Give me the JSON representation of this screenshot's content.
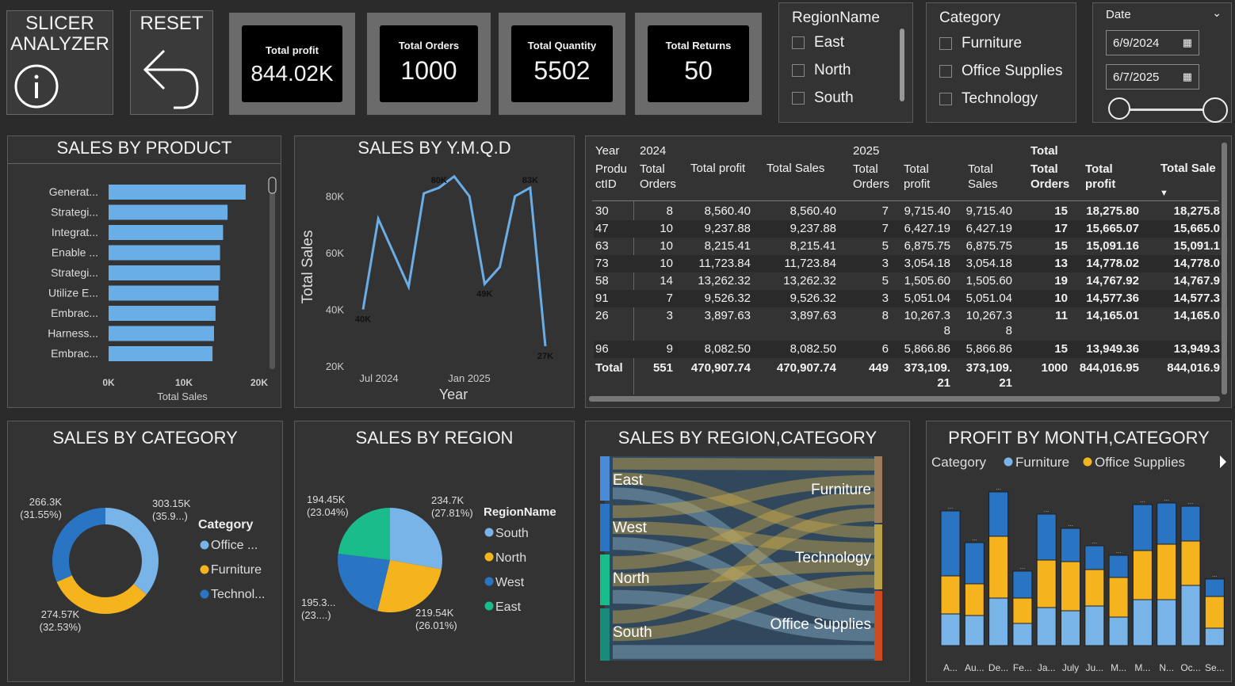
{
  "app": {
    "title_line1": "SLICER",
    "title_line2": "ANALYZER",
    "reset_label": "RESET"
  },
  "kpis": [
    {
      "label": "Total profit",
      "value": "844.02K"
    },
    {
      "label": "Total Orders",
      "value": "1000"
    },
    {
      "label": "Total Quantity",
      "value": "5502"
    },
    {
      "label": "Total Returns",
      "value": "50"
    }
  ],
  "region_slicer": {
    "title": "RegionName",
    "items": [
      "East",
      "North",
      "South"
    ]
  },
  "category_slicer": {
    "title": "Category",
    "items": [
      "Furniture",
      "Office Supplies",
      "Technology"
    ]
  },
  "date_slicer": {
    "title": "Date",
    "start": "6/9/2024",
    "end": "6/7/2025"
  },
  "colors": {
    "furniture": "#f5b41e",
    "office": "#79b4e8",
    "technology": "#2a74c4",
    "bar": "#6aaee8",
    "east": "#1abc8c",
    "sankey_band": "#c9a94a"
  },
  "titles": {
    "product": "SALES BY PRODUCT",
    "ymqd": "SALES BY Y.M.Q.D",
    "category": "SALES BY CATEGORY",
    "region": "SALES BY REGION",
    "region_category": "SALES BY REGION,CATEGORY",
    "profit_month": "PROFIT BY MONTH,CATEGORY"
  },
  "matrix": {
    "year_label": "Year",
    "y2024": "2024",
    "y2025": "2025",
    "total_label": "Total",
    "productid_label": "Produ ctID",
    "col_headers": [
      "Total Orders",
      "Total profit",
      "Total Sales",
      "Total Orders",
      "Total profit",
      "Total Sales",
      "Total Orders",
      "Total profit",
      "Total Sale"
    ],
    "rows": [
      [
        "30",
        "8",
        "8,560.40",
        "8,560.40",
        "7",
        "9,715.40",
        "9,715.40",
        "15",
        "18,275.80",
        "18,275.8"
      ],
      [
        "47",
        "10",
        "9,237.88",
        "9,237.88",
        "7",
        "6,427.19",
        "6,427.19",
        "17",
        "15,665.07",
        "15,665.0"
      ],
      [
        "63",
        "10",
        "8,215.41",
        "8,215.41",
        "5",
        "6,875.75",
        "6,875.75",
        "15",
        "15,091.16",
        "15,091.1"
      ],
      [
        "73",
        "10",
        "11,723.84",
        "11,723.84",
        "3",
        "3,054.18",
        "3,054.18",
        "13",
        "14,778.02",
        "14,778.0"
      ],
      [
        "58",
        "14",
        "13,262.32",
        "13,262.32",
        "5",
        "1,505.60",
        "1,505.60",
        "19",
        "14,767.92",
        "14,767.9"
      ],
      [
        "91",
        "7",
        "9,526.32",
        "9,526.32",
        "3",
        "5,051.04",
        "5,051.04",
        "10",
        "14,577.36",
        "14,577.3"
      ],
      [
        "26",
        "3",
        "3,897.63",
        "3,897.63",
        "8",
        "10,267.3 8",
        "10,267.3 8",
        "11",
        "14,165.01",
        "14,165.0"
      ],
      [
        "96",
        "9",
        "8,082.50",
        "8,082.50",
        "6",
        "5,866.86",
        "5,866.86",
        "15",
        "13,949.36",
        "13,949.3"
      ]
    ],
    "total_row": [
      "Total",
      "551",
      "470,907.74",
      "470,907.74",
      "449",
      "373,109. 21",
      "373,109. 21",
      "1000",
      "844,016.95",
      "844,016.9"
    ]
  },
  "chart_data": [
    {
      "id": "product",
      "type": "bar",
      "orientation": "horizontal",
      "categories": [
        "Generat...",
        "Strategi...",
        "Integrat...",
        "Enable ...",
        "Strategi...",
        "Utilize E...",
        "Embrac...",
        "Harness...",
        "Embrac..."
      ],
      "values": [
        18200,
        15800,
        15200,
        14800,
        14800,
        14600,
        14200,
        14000,
        13800
      ],
      "xlabel": "Total Sales",
      "xticks": [
        "0K",
        "10K",
        "20K"
      ],
      "xlim": [
        0,
        20000
      ]
    },
    {
      "id": "ymqd",
      "type": "line",
      "xlabel": "Year",
      "ylabel": "Total Sales",
      "yticks": [
        "20K",
        "40K",
        "60K",
        "80K"
      ],
      "ylim": [
        20000,
        90000
      ],
      "xticks": [
        "Jul 2024",
        "Jan 2025"
      ],
      "values": [
        40000,
        72000,
        60000,
        48000,
        81000,
        83000,
        87000,
        80000,
        49000,
        55000,
        80000,
        83000,
        27000
      ],
      "data_labels": [
        "40K",
        "80K",
        "49K",
        "83K",
        "27K"
      ]
    },
    {
      "id": "category",
      "type": "pie",
      "donut": true,
      "legend_title": "Category",
      "slices": [
        {
          "name": "Office ...",
          "value": 303150,
          "label": "303.15K",
          "pct": "(35.9...)"
        },
        {
          "name": "Furniture",
          "value": 274570,
          "label": "274.57K",
          "pct": "(32.53%)"
        },
        {
          "name": "Technol...",
          "value": 266300,
          "label": "266.3K",
          "pct": "(31.55%)"
        }
      ]
    },
    {
      "id": "region",
      "type": "pie",
      "legend_title": "RegionName",
      "slices": [
        {
          "name": "South",
          "value": 234700,
          "label": "234.7K",
          "pct": "(27.81%)"
        },
        {
          "name": "North",
          "value": 219540,
          "label": "219.54K",
          "pct": "(26.01%)"
        },
        {
          "name": "West",
          "value": 195300,
          "label": "195.3...",
          "pct": "(23....)"
        },
        {
          "name": "East",
          "value": 194450,
          "label": "194.45K",
          "pct": "(23.04%)"
        }
      ]
    },
    {
      "id": "region_category",
      "type": "sankey",
      "sources": [
        "East",
        "West",
        "North",
        "South"
      ],
      "targets": [
        "Furniture",
        "Technology",
        "Office Supplies"
      ]
    },
    {
      "id": "profit_month",
      "type": "bar",
      "stacked": true,
      "legend_title": "Category",
      "legend": [
        "Furniture",
        "Office Supplies"
      ],
      "categories": [
        "A...",
        "Au...",
        "De...",
        "Fe...",
        "Ja...",
        "July",
        "Ju...",
        "M...",
        "M...",
        "N...",
        "Oc...",
        "Se..."
      ],
      "series": [
        {
          "name": "Office Supplies",
          "values": [
            40,
            38,
            60,
            28,
            48,
            44,
            50,
            36,
            58,
            58,
            76,
            22
          ]
        },
        {
          "name": "Furniture",
          "values": [
            48,
            40,
            78,
            32,
            60,
            62,
            46,
            50,
            62,
            70,
            56,
            40
          ]
        },
        {
          "name": "Technology",
          "values": [
            82,
            52,
            56,
            34,
            58,
            42,
            30,
            28,
            58,
            52,
            44,
            22
          ]
        }
      ]
    }
  ]
}
